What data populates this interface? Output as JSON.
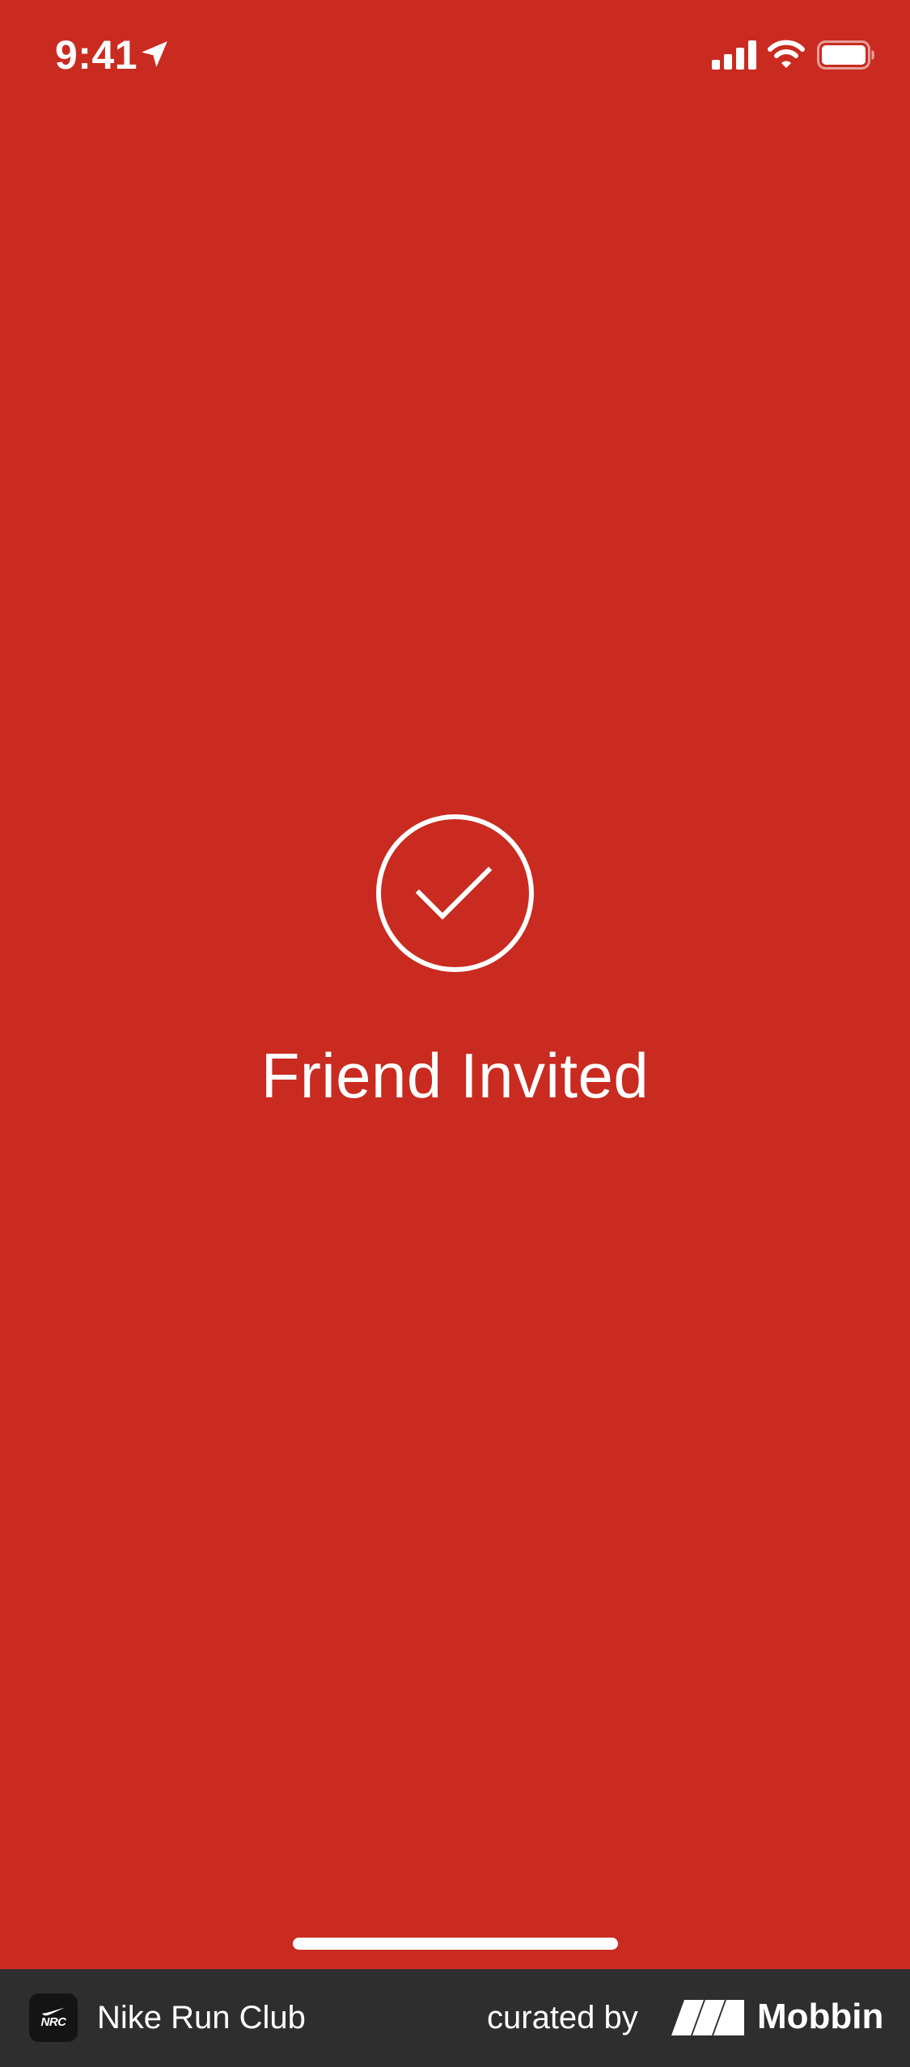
{
  "status_bar": {
    "time": "9:41",
    "icons": [
      "location-arrow-icon",
      "cellular-signal-icon",
      "wifi-icon",
      "battery-icon"
    ]
  },
  "confirmation": {
    "icon": "checkmark-circle-icon",
    "title": "Friend Invited"
  },
  "footer": {
    "app_icon_text": "NRC",
    "app_name": "Nike Run Club",
    "curated_label": "curated by",
    "brand": "Mobbin"
  },
  "colors": {
    "background": "#C92B20",
    "foreground": "#FFFFFF",
    "footer_background": "#2E2E2E"
  }
}
